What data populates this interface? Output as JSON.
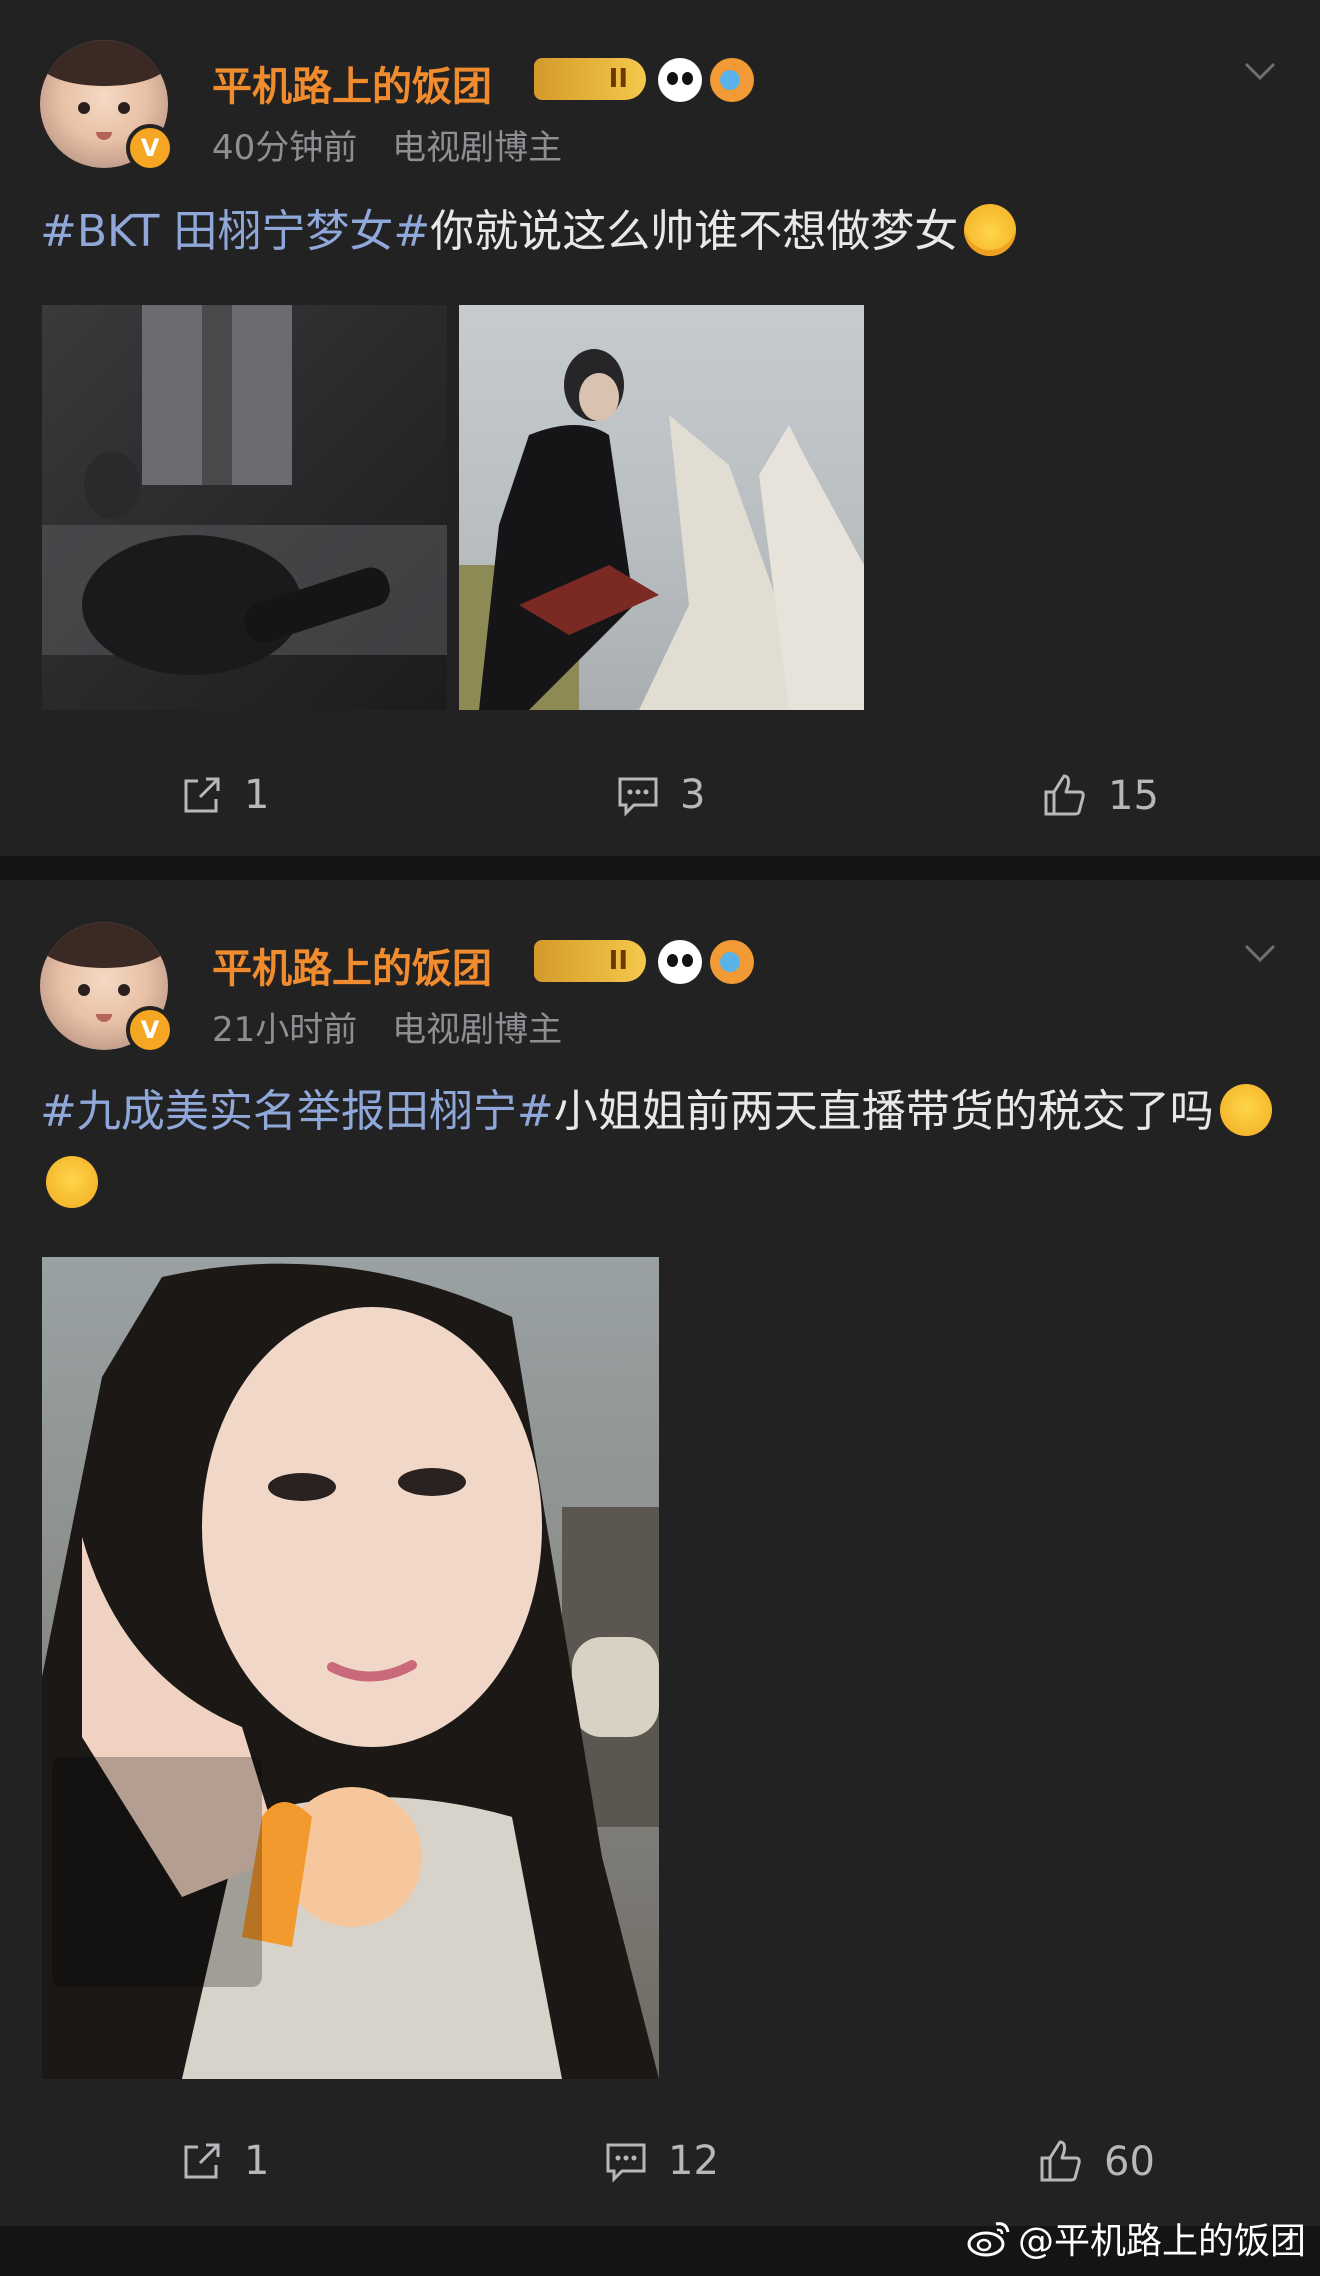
{
  "posts": [
    {
      "username": "平机路上的饭团",
      "level_badge": "II",
      "time": "40分钟前",
      "author_tag": "电视剧博主",
      "hashtag": "#BKT 田栩宁梦女#",
      "body": "你就说这么帅谁不想做梦女",
      "actions": {
        "repost": "1",
        "comment": "3",
        "like": "15"
      }
    },
    {
      "username": "平机路上的饭团",
      "level_badge": "II",
      "time": "21小时前",
      "author_tag": "电视剧博主",
      "hashtag": "#九成美实名举报田栩宁#",
      "body": "小姐姐前两天直播带货的税交了吗",
      "actions": {
        "repost": "1",
        "comment": "12",
        "like": "60"
      }
    }
  ],
  "watermark": "@平机路上的饭团",
  "icons": {
    "verified": "V",
    "repost": "repost-icon",
    "comment": "comment-icon",
    "like": "thumbs-up-icon",
    "more": "chevron-down-icon"
  },
  "colors": {
    "username": "#f08c2e",
    "hashtag": "#8fa7d9",
    "background": "#222223"
  }
}
